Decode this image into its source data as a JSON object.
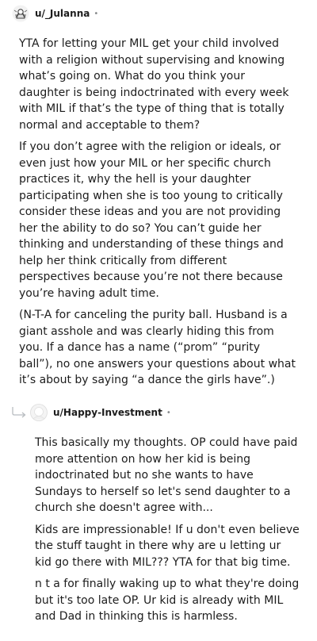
{
  "comments": [
    {
      "username": "u/_Julanna",
      "separator": "•",
      "paragraphs": [
        "YTA for letting your MIL get your child involved with a religion without supervising and knowing what’s going on. What do you think your daughter is being indoctrinated with every week with MIL if that’s the type of thing that is totally normal and acceptable to them?",
        "If you don’t agree with the religion or ideals, or even just how your MIL or her specific church practices it, why the hell is your daughter participating when she is too young to critically consider these ideas and you are not providing her the ability to do so? You can’t guide her thinking and understanding of these things and help her think critically from different perspectives because you’re not there because you’re having adult time.",
        "(N-T-A for canceling the purity ball. Husband is a giant asshole and was clearly hiding this from you. If a dance has a name (“prom” “purity ball”), no one answers your questions about what it’s about by saying “a dance the girls have”.)"
      ]
    },
    {
      "username": "u/Happy-Investment",
      "separator": "•",
      "paragraphs": [
        "This basically my thoughts. OP could have paid more attention on how her kid is being indoctrinated but no she wants to have Sundays to herself so let's send daughter to a church she doesn't agree with...",
        "Kids are impressionable! If u don't even believe the stuff taught in there why are u letting ur kid go there with MIL??? YTA for that big time.",
        "n t a for finally waking up to what they're doing but it's too late OP. Ur kid is already with MIL and Dad in thinking this is harmless."
      ]
    }
  ]
}
